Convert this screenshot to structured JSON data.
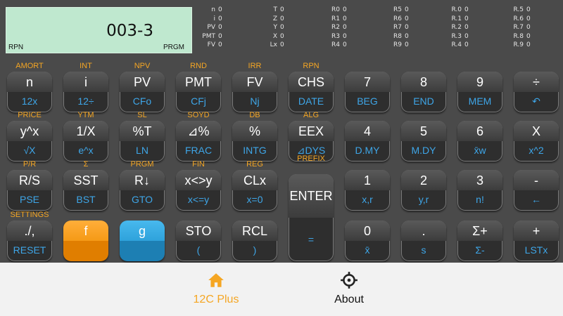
{
  "display": {
    "value": "003-3",
    "mode": "RPN",
    "prgm": "PRGM"
  },
  "registers": {
    "col1": [
      [
        "n",
        "0"
      ],
      [
        "i",
        "0"
      ],
      [
        "PV",
        "0"
      ],
      [
        "PMT",
        "0"
      ],
      [
        "FV",
        "0"
      ]
    ],
    "col2": [
      [
        "T",
        "0"
      ],
      [
        "Z",
        "0"
      ],
      [
        "Y",
        "0"
      ],
      [
        "X",
        "0"
      ],
      [
        "Lx",
        "0"
      ]
    ],
    "col3": [
      [
        "R0",
        "0"
      ],
      [
        "R1",
        "0"
      ],
      [
        "R2",
        "0"
      ],
      [
        "R3",
        "0"
      ],
      [
        "R4",
        "0"
      ]
    ],
    "col4": [
      [
        "R5",
        "0"
      ],
      [
        "R6",
        "0"
      ],
      [
        "R7",
        "0"
      ],
      [
        "R8",
        "0"
      ],
      [
        "R9",
        "0"
      ]
    ],
    "col5": [
      [
        "R.0",
        "0"
      ],
      [
        "R.1",
        "0"
      ],
      [
        "R.2",
        "0"
      ],
      [
        "R.3",
        "0"
      ],
      [
        "R.4",
        "0"
      ]
    ],
    "col6": [
      [
        "R.5",
        "0"
      ],
      [
        "R.6",
        "0"
      ],
      [
        "R.7",
        "0"
      ],
      [
        "R.8",
        "0"
      ],
      [
        "R.9",
        "0"
      ]
    ]
  },
  "keys": {
    "r1": [
      {
        "f": "AMORT",
        "top": "n",
        "bot": "12x"
      },
      {
        "f": "INT",
        "top": "i",
        "bot": "12÷"
      },
      {
        "f": "NPV",
        "top": "PV",
        "bot": "CFo"
      },
      {
        "f": "RND",
        "top": "PMT",
        "bot": "CFj"
      },
      {
        "f": "IRR",
        "top": "FV",
        "bot": "Nj"
      },
      {
        "f": "RPN",
        "top": "CHS",
        "bot": "DATE"
      },
      {
        "f": "",
        "top": "7",
        "bot": "BEG"
      },
      {
        "f": "",
        "top": "8",
        "bot": "END"
      },
      {
        "f": "",
        "top": "9",
        "bot": "MEM"
      },
      {
        "f": "",
        "top": "÷",
        "bot": "↶"
      }
    ],
    "r2": [
      {
        "f": "PRICE",
        "top": "y^x",
        "bot": "√X"
      },
      {
        "f": "YTM",
        "top": "1/X",
        "bot": "e^x"
      },
      {
        "f": "SL",
        "top": "%T",
        "bot": "LN"
      },
      {
        "f": "SOYD",
        "top": "⊿%",
        "bot": "FRAC"
      },
      {
        "f": "DB",
        "top": "%",
        "bot": "INTG"
      },
      {
        "f": "ALG",
        "top": "EEX",
        "bot": "⊿DYS"
      },
      {
        "f": "",
        "top": "4",
        "bot": "D.MY"
      },
      {
        "f": "",
        "top": "5",
        "bot": "M.DY"
      },
      {
        "f": "",
        "top": "6",
        "bot": "x̄w"
      },
      {
        "f": "",
        "top": "X",
        "bot": "x^2"
      }
    ],
    "r3": [
      {
        "f": "P/R",
        "top": "R/S",
        "bot": "PSE"
      },
      {
        "f": "Σ",
        "top": "SST",
        "bot": "BST"
      },
      {
        "f": "PRGM",
        "top": "R↓",
        "bot": "GTO"
      },
      {
        "f": "FIN",
        "top": "x<>y",
        "bot": "x<=y"
      },
      {
        "f": "REG",
        "top": "CLx",
        "bot": "x=0"
      },
      {
        "f": "",
        "top": "1",
        "bot": "x,r"
      },
      {
        "f": "",
        "top": "2",
        "bot": "y,r"
      },
      {
        "f": "",
        "top": "3",
        "bot": "n!"
      },
      {
        "f": "",
        "top": "-",
        "bot": "←"
      }
    ],
    "r4": [
      {
        "f": "SETTINGS",
        "top": "./,",
        "bot": "RESET"
      },
      {
        "f": "",
        "top": "f",
        "bot": ""
      },
      {
        "f": "",
        "top": "g",
        "bot": ""
      },
      {
        "f": "",
        "top": "STO",
        "bot": "("
      },
      {
        "f": "",
        "top": "RCL",
        "bot": ")"
      },
      {
        "f": "",
        "top": "0",
        "bot": "x̄"
      },
      {
        "f": "",
        "top": ".",
        "bot": "s"
      },
      {
        "f": "",
        "top": "Σ+",
        "bot": "Σ-"
      },
      {
        "f": "",
        "top": "+",
        "bot": "LSTx"
      }
    ],
    "enter": {
      "f": "PREFIX",
      "top": "ENTER",
      "bot": "="
    }
  },
  "colors": {
    "f_label": "#f5a623",
    "g_label": "#3ea6e8",
    "f_key": "#f59a16",
    "g_key": "#2ea2db"
  },
  "nav": {
    "home": {
      "label": "12C Plus",
      "icon": "home-icon"
    },
    "about": {
      "label": "About",
      "icon": "crosshair-icon"
    }
  }
}
